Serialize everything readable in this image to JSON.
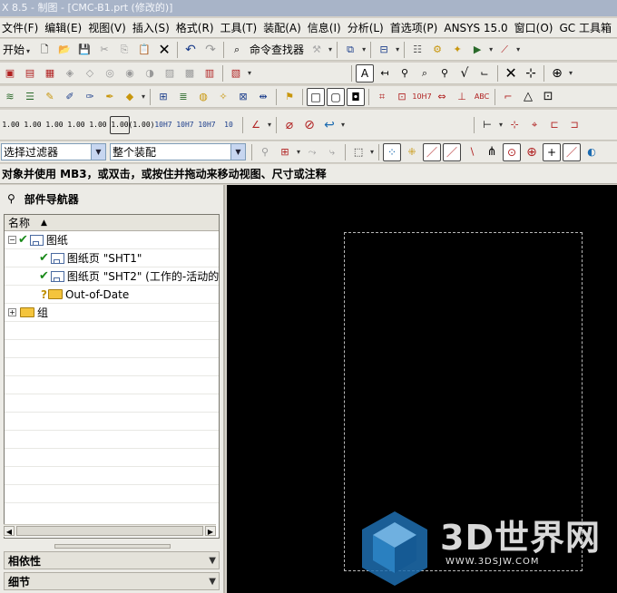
{
  "window": {
    "title": "X 8.5 - 制图 - [CMC-B1.prt (修改的)]"
  },
  "menu": [
    "文件(F)",
    "编辑(E)",
    "视图(V)",
    "插入(S)",
    "格式(R)",
    "工具(T)",
    "装配(A)",
    "信息(I)",
    "分析(L)",
    "首选项(P)",
    "ANSYS 15.0",
    "窗口(O)",
    "GC 工具箱"
  ],
  "toolbar1": {
    "start_label": "开始",
    "find_command_label": "命令查找器"
  },
  "toolbar4": {
    "tolerance_labels": [
      "1.00",
      "1.00",
      "1.00",
      "1.00",
      "1.00",
      "1.00",
      "(1.00)",
      "10H7",
      "10H7",
      "10H7",
      "10"
    ]
  },
  "selection": {
    "filter_value": "选择过滤器",
    "scope_value": "整个装配"
  },
  "status": {
    "prompt": "对象并使用 MB3，或双击，或按住并拖动来移动视图、尺寸或注释"
  },
  "navigator": {
    "title": "部件导航器",
    "column_header": "名称",
    "tree": [
      {
        "label": "图纸",
        "level": 0,
        "expander": "−",
        "status": "check",
        "icon": "drawing"
      },
      {
        "label": "图纸页 \"SHT1\"",
        "level": 1,
        "status": "check",
        "icon": "sheet"
      },
      {
        "label": "图纸页 \"SHT2\" (工作的-活动的",
        "level": 1,
        "status": "check",
        "icon": "sheet"
      },
      {
        "label": "Out-of-Date",
        "level": 1,
        "status": "question",
        "icon": "folder"
      },
      {
        "label": "组",
        "level": 0,
        "expander": "+",
        "status": "",
        "icon": "folder"
      }
    ],
    "panels": [
      "相依性",
      "细节"
    ]
  },
  "watermark": {
    "brand": "3D世界网",
    "url": "WWW.3DSJW.COM"
  },
  "colors": {
    "graphics_bg": "#000000",
    "check_green": "#1a8a1a",
    "folder_yellow": "#f4c43c",
    "watermark_blue": "#1f6fb0"
  }
}
